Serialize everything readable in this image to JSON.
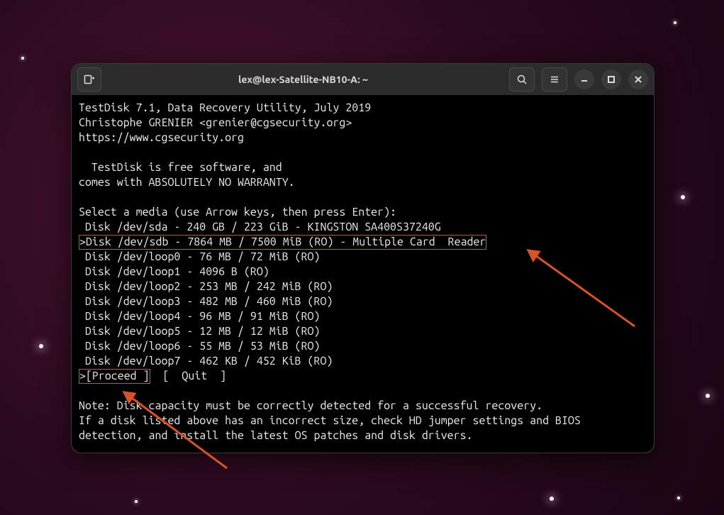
{
  "window": {
    "title": "lex@lex-Satellite-NB10-A: ~"
  },
  "testdisk": {
    "header1": "TestDisk 7.1, Data Recovery Utility, July 2019",
    "header2": "Christophe GRENIER <grenier@cgsecurity.org>",
    "header3": "https://www.cgsecurity.org",
    "intro1": "  TestDisk is free software, and",
    "intro2": "comes with ABSOLUTELY NO WARRANTY.",
    "select_prompt": "Select a media (use Arrow keys, then press Enter):",
    "disks": [
      " Disk /dev/sda - 240 GB / 223 GiB - KINGSTON SA400S37240G",
      ">Disk /dev/sdb - 7864 MB / 7500 MiB (RO) - Multiple Card  Reader",
      " Disk /dev/loop0 - 76 MB / 72 MiB (RO)",
      " Disk /dev/loop1 - 4096 B (RO)",
      " Disk /dev/loop2 - 253 MB / 242 MiB (RO)",
      " Disk /dev/loop3 - 482 MB / 460 MiB (RO)",
      " Disk /dev/loop4 - 96 MB / 91 MiB (RO)",
      " Disk /dev/loop5 - 12 MB / 12 MiB (RO)",
      " Disk /dev/loop6 - 55 MB / 53 MiB (RO)",
      " Disk /dev/loop7 - 462 KB / 452 KiB (RO)"
    ],
    "menu_proceed": ">[Proceed ]",
    "menu_quit": "  [  Quit  ]",
    "note1": "Note: Disk capacity must be correctly detected for a successful recovery.",
    "note2": "If a disk listed above has an incorrect size, check HD jumper settings and BIOS",
    "note3": "detection, and install the latest OS patches and disk drivers."
  }
}
